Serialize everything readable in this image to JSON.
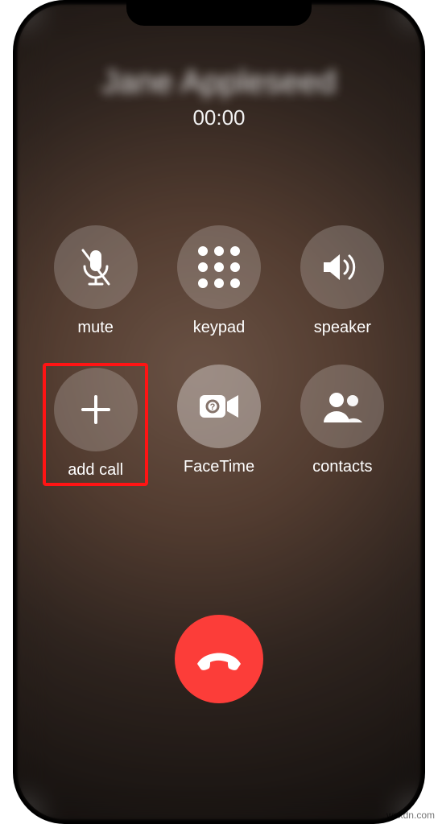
{
  "caller_name": "Jane Appleseed",
  "call_timer": "00:00",
  "buttons": {
    "mute": {
      "label": "mute"
    },
    "keypad": {
      "label": "keypad"
    },
    "speaker": {
      "label": "speaker"
    },
    "add_call": {
      "label": "add call"
    },
    "facetime": {
      "label": "FaceTime"
    },
    "contacts": {
      "label": "contacts"
    }
  },
  "end_call_color": "#fc3d39",
  "highlight_color": "#ff1414",
  "watermark": "wsxdn.com"
}
